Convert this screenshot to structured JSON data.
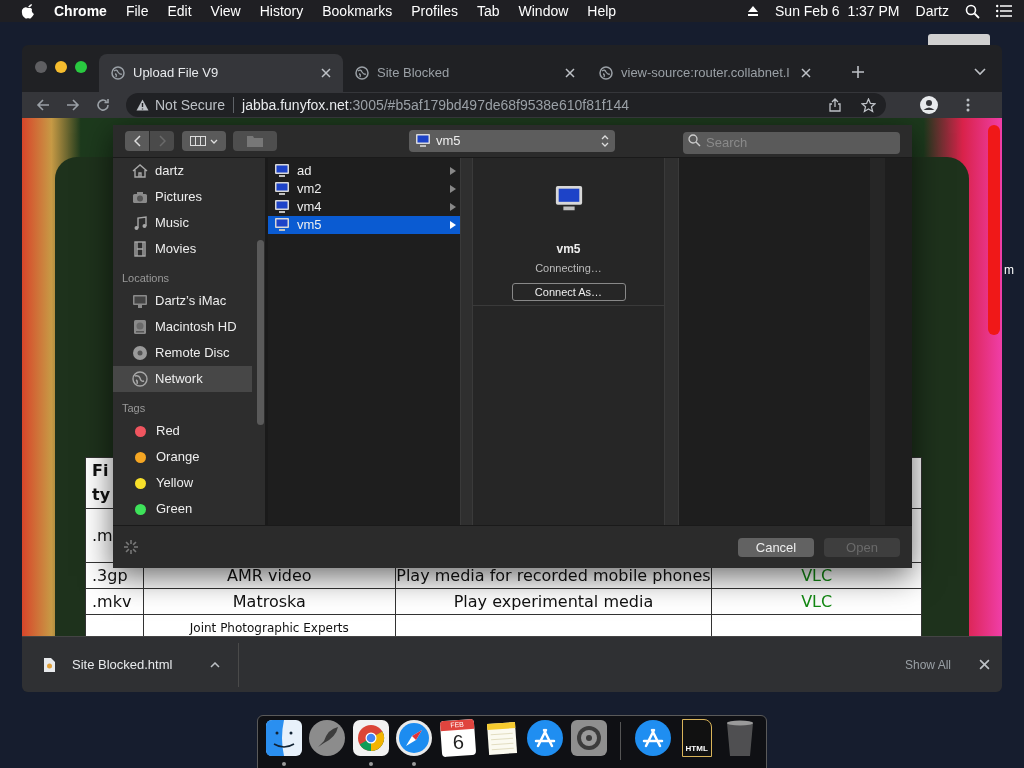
{
  "menu_bar": {
    "app": "Chrome",
    "items": [
      "File",
      "Edit",
      "View",
      "History",
      "Bookmarks",
      "Profiles",
      "Tab",
      "Window",
      "Help"
    ],
    "clock": "Sun Feb 6  1:37 PM",
    "user": "Dartz"
  },
  "desktop": {
    "edge_text": "m"
  },
  "browser": {
    "tabs": [
      {
        "title": "Upload File V9",
        "selected": true
      },
      {
        "title": "Site Blocked",
        "selected": false
      },
      {
        "title": "view-source:router.collabnet.l",
        "selected": false
      }
    ],
    "address": {
      "security": "Not Secure",
      "host": "jabba.funyfox.net",
      "path": ":3005/#b5af179bd497de68f9538e610f81f144"
    }
  },
  "page": {
    "table": {
      "rows": [
        {
          "column_1": "Fi\nty"
        },
        {
          "column_1": ".m"
        },
        {
          "column_1": ".3gp",
          "column_2": "AMR video",
          "column_3": "Play media for recorded mobile phones",
          "column_4": "VLC"
        },
        {
          "column_1": ".mkv",
          "column_2": "Matroska",
          "column_3": "Play experimental media",
          "column_4": "VLC"
        },
        {
          "column_2": "Joint Photographic Experts"
        }
      ]
    }
  },
  "dialog": {
    "toolbar": {
      "back_disabled": false,
      "forward_disabled": true,
      "new_folder_disabled": true
    },
    "location": "vm5",
    "search_placeholder": "Search",
    "sidebar": {
      "sections": [
        {
          "items": [
            {
              "label": "dartz",
              "kind": "home",
              "selected": false
            },
            {
              "label": "Pictures",
              "kind": "camera",
              "selected": false
            },
            {
              "label": "Music",
              "kind": "music",
              "selected": false
            },
            {
              "label": "Movies",
              "kind": "film",
              "selected": false
            }
          ]
        },
        {
          "title": "Locations",
          "items": [
            {
              "label": "Dartz’s iMac",
              "kind": "computer",
              "selected": false
            },
            {
              "label": "Macintosh HD",
              "kind": "disk",
              "selected": false
            },
            {
              "label": "Remote Disc",
              "kind": "disc",
              "selected": false
            },
            {
              "label": "Network",
              "kind": "network",
              "selected": true
            }
          ]
        },
        {
          "title": "Tags",
          "items": [
            {
              "label": "Red",
              "kind": "tag",
              "color": "#f0555f",
              "selected": false
            },
            {
              "label": "Orange",
              "kind": "tag",
              "color": "#f5a623",
              "selected": false
            },
            {
              "label": "Yellow",
              "kind": "tag",
              "color": "#f8e02a",
              "selected": false
            },
            {
              "label": "Green",
              "kind": "tag",
              "color": "#3ee25a",
              "selected": false
            }
          ]
        }
      ]
    },
    "column": {
      "items": [
        {
          "label": "ad",
          "selected": false
        },
        {
          "label": "vm2",
          "selected": false
        },
        {
          "label": "vm4",
          "selected": false
        },
        {
          "label": "vm5",
          "selected": true
        }
      ]
    },
    "preview": {
      "name": "vm5",
      "status": "Connecting…",
      "button": "Connect As…"
    },
    "busy": true,
    "buttons": [
      {
        "label": "Cancel",
        "disabled": false
      },
      {
        "label": "Open",
        "disabled": true
      }
    ]
  },
  "download_bar": {
    "file": "Site Blocked.html",
    "show_all": "Show All"
  },
  "dock": {
    "items": [
      {
        "kind": "finder",
        "running": true
      },
      {
        "kind": "launchpad",
        "running": false
      },
      {
        "kind": "chrome",
        "running": true
      },
      {
        "kind": "safari",
        "running": true
      },
      {
        "kind": "calendar",
        "running": false,
        "month": "FEB",
        "day": "6"
      },
      {
        "kind": "notes",
        "running": false
      },
      {
        "kind": "appstore",
        "running": false
      },
      {
        "kind": "preferences",
        "running": false
      },
      {
        "kind": "separator"
      },
      {
        "kind": "appstore",
        "running": false
      },
      {
        "kind": "document",
        "running": false,
        "label": "HTML"
      },
      {
        "kind": "trash",
        "running": false
      }
    ]
  }
}
